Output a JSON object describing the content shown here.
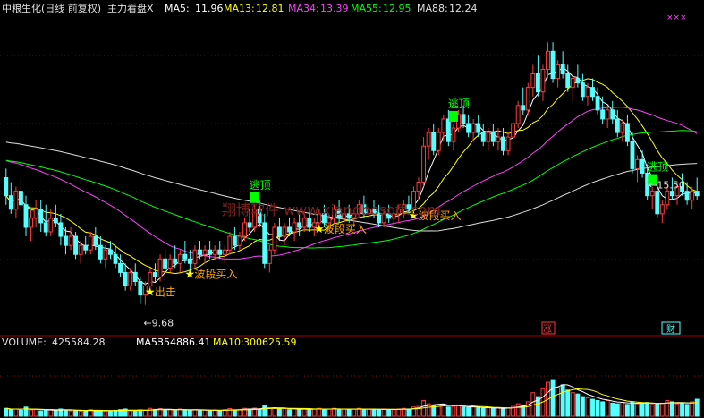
{
  "header": {
    "stock_name": "中粮生化(日线 前复权)",
    "indicator": "主力看盘X",
    "ma5_label": "MA5:",
    "ma5_value": "11.96",
    "ma13_label": "MA13:",
    "ma13_value": "12.81",
    "ma34_label": "MA34:",
    "ma34_value": "13.39",
    "ma55_label": "MA55:",
    "ma55_value": "12.95",
    "ma88_label": "MA88:",
    "ma88_value": "12.24",
    "close_marks": "×××"
  },
  "volume_header": {
    "volume_label": "VOLUME:",
    "volume_value": "425584.28",
    "ma5_label": "MA5:",
    "ma5_value": "354886.41",
    "ma10_label": "MA10:",
    "ma10_value": "300625.59"
  },
  "watermark": "翔博软件 www.xiangbosoft.com",
  "badges": {
    "zhang": "涨",
    "caibao": "财"
  },
  "colors": {
    "up": "#ff3b3b",
    "down": "#54ffff",
    "ma5": "#ffffff",
    "ma13": "#ffff00",
    "ma34": "#ff40ff",
    "ma55": "#00ff00",
    "ma88": "#dddddd",
    "signal": "#ffa500",
    "escape": "#00ff00",
    "grid": "#a00000"
  },
  "chart_data": {
    "type": "candlestick",
    "price_ylim": [
      9.0,
      16.0
    ],
    "volume_ylim": [
      0,
      500000
    ],
    "annotations": [
      {
        "text": "逃顶",
        "bar": 50
      },
      {
        "text": "逃顶",
        "bar": 90
      },
      {
        "text": "逃顶",
        "bar": 130
      },
      {
        "text": "出击",
        "bar": 29
      },
      {
        "text": "波段买入",
        "bar": 37
      },
      {
        "text": "波段买入",
        "bar": 63
      },
      {
        "text": "波段买入",
        "bar": 82
      },
      {
        "text": "15.50",
        "bar": 130
      },
      {
        "text": "9.68",
        "bar": 28
      }
    ],
    "ohlc": [
      [
        12.5,
        12.7,
        11.9,
        12.1
      ],
      [
        12.1,
        12.4,
        11.7,
        11.8
      ],
      [
        11.8,
        12.3,
        11.6,
        12.2
      ],
      [
        12.2,
        12.5,
        11.8,
        11.9
      ],
      [
        11.9,
        12.1,
        11.2,
        11.4
      ],
      [
        11.4,
        11.8,
        11.1,
        11.6
      ],
      [
        11.6,
        12.0,
        11.4,
        11.8
      ],
      [
        11.8,
        12.0,
        11.3,
        11.5
      ],
      [
        11.5,
        11.9,
        11.2,
        11.3
      ],
      [
        11.3,
        11.8,
        11.2,
        11.6
      ],
      [
        11.6,
        11.9,
        11.4,
        11.5
      ],
      [
        11.5,
        11.7,
        11.0,
        11.2
      ],
      [
        11.2,
        11.4,
        10.8,
        11.0
      ],
      [
        11.0,
        11.4,
        10.9,
        11.2
      ],
      [
        11.2,
        11.3,
        10.7,
        10.8
      ],
      [
        10.8,
        11.1,
        10.6,
        11.0
      ],
      [
        11.0,
        11.2,
        10.8,
        10.9
      ],
      [
        10.9,
        11.3,
        10.8,
        11.2
      ],
      [
        11.2,
        11.4,
        10.9,
        11.0
      ],
      [
        11.0,
        11.2,
        10.6,
        10.7
      ],
      [
        10.7,
        11.0,
        10.5,
        10.9
      ],
      [
        10.9,
        11.1,
        10.7,
        10.8
      ],
      [
        10.8,
        11.0,
        10.5,
        10.6
      ],
      [
        10.6,
        10.8,
        10.3,
        10.4
      ],
      [
        10.4,
        10.6,
        10.0,
        10.1
      ],
      [
        10.1,
        10.5,
        10.0,
        10.4
      ],
      [
        10.4,
        10.6,
        10.1,
        10.2
      ],
      [
        10.2,
        10.3,
        9.7,
        9.9
      ],
      [
        9.9,
        10.2,
        9.68,
        10.1
      ],
      [
        10.1,
        10.5,
        10.0,
        10.4
      ],
      [
        10.4,
        10.6,
        10.2,
        10.3
      ],
      [
        10.3,
        10.8,
        10.2,
        10.7
      ],
      [
        10.7,
        10.9,
        10.4,
        10.5
      ],
      [
        10.5,
        10.8,
        10.4,
        10.7
      ],
      [
        10.7,
        11.0,
        10.5,
        10.6
      ],
      [
        10.6,
        10.9,
        10.4,
        10.8
      ],
      [
        10.8,
        11.1,
        10.6,
        10.7
      ],
      [
        10.7,
        10.9,
        10.4,
        10.6
      ],
      [
        10.6,
        11.0,
        10.5,
        10.9
      ],
      [
        10.9,
        11.1,
        10.7,
        10.8
      ],
      [
        10.8,
        11.0,
        10.6,
        10.9
      ],
      [
        10.9,
        11.1,
        10.7,
        10.8
      ],
      [
        10.8,
        11.0,
        10.7,
        10.9
      ],
      [
        10.9,
        11.1,
        10.7,
        10.8
      ],
      [
        10.8,
        11.0,
        10.6,
        10.9
      ],
      [
        10.9,
        11.3,
        10.8,
        11.2
      ],
      [
        11.2,
        11.4,
        10.9,
        11.0
      ],
      [
        11.0,
        11.3,
        10.9,
        11.2
      ],
      [
        11.2,
        11.6,
        11.1,
        11.5
      ],
      [
        11.5,
        11.8,
        11.3,
        11.4
      ],
      [
        11.4,
        11.9,
        11.3,
        11.8
      ],
      [
        11.8,
        12.0,
        11.4,
        11.5
      ],
      [
        11.5,
        11.7,
        10.5,
        10.6
      ],
      [
        10.6,
        11.0,
        10.4,
        10.9
      ],
      [
        10.9,
        11.5,
        10.8,
        11.4
      ],
      [
        11.4,
        11.6,
        11.1,
        11.2
      ],
      [
        11.2,
        11.5,
        11.0,
        11.4
      ],
      [
        11.4,
        11.6,
        11.2,
        11.3
      ],
      [
        11.3,
        11.6,
        11.1,
        11.5
      ],
      [
        11.5,
        11.7,
        11.2,
        11.4
      ],
      [
        11.4,
        11.7,
        11.3,
        11.6
      ],
      [
        11.6,
        11.8,
        11.3,
        11.4
      ],
      [
        11.4,
        11.6,
        11.2,
        11.5
      ],
      [
        11.5,
        11.8,
        11.4,
        11.7
      ],
      [
        11.7,
        11.9,
        11.4,
        11.5
      ],
      [
        11.5,
        11.7,
        11.3,
        11.6
      ],
      [
        11.6,
        11.9,
        11.5,
        11.8
      ],
      [
        11.8,
        12.0,
        11.5,
        11.6
      ],
      [
        11.6,
        11.8,
        11.4,
        11.7
      ],
      [
        11.7,
        11.9,
        11.5,
        11.6
      ],
      [
        11.6,
        11.8,
        11.4,
        11.7
      ],
      [
        11.7,
        12.0,
        11.6,
        11.9
      ],
      [
        11.9,
        12.1,
        11.6,
        11.7
      ],
      [
        11.7,
        11.9,
        11.5,
        11.8
      ],
      [
        11.8,
        12.0,
        11.6,
        11.7
      ],
      [
        11.7,
        11.9,
        11.4,
        11.5
      ],
      [
        11.5,
        11.8,
        11.4,
        11.7
      ],
      [
        11.7,
        11.9,
        11.5,
        11.6
      ],
      [
        11.6,
        11.8,
        11.4,
        11.7
      ],
      [
        11.7,
        11.9,
        11.5,
        11.8
      ],
      [
        11.8,
        12.0,
        11.6,
        11.9
      ],
      [
        11.9,
        12.1,
        11.7,
        11.8
      ],
      [
        11.8,
        12.3,
        11.7,
        12.2
      ],
      [
        12.2,
        12.5,
        12.0,
        12.4
      ],
      [
        12.4,
        13.4,
        12.3,
        13.2
      ],
      [
        13.2,
        13.6,
        12.9,
        13.5
      ],
      [
        13.5,
        13.7,
        13.0,
        13.1
      ],
      [
        13.1,
        13.6,
        13.0,
        13.5
      ],
      [
        13.5,
        13.9,
        13.3,
        13.8
      ],
      [
        13.8,
        14.0,
        13.2,
        13.3
      ],
      [
        13.3,
        13.7,
        13.1,
        13.6
      ],
      [
        13.6,
        14.0,
        13.5,
        13.9
      ],
      [
        13.9,
        14.1,
        13.6,
        13.7
      ],
      [
        13.7,
        13.9,
        13.4,
        13.5
      ],
      [
        13.5,
        13.8,
        13.3,
        13.7
      ],
      [
        13.7,
        13.9,
        13.4,
        13.5
      ],
      [
        13.5,
        13.7,
        13.2,
        13.3
      ],
      [
        13.3,
        13.6,
        13.1,
        13.5
      ],
      [
        13.5,
        13.7,
        13.2,
        13.3
      ],
      [
        13.3,
        13.6,
        13.1,
        13.4
      ],
      [
        13.4,
        13.6,
        13.0,
        13.1
      ],
      [
        13.1,
        13.5,
        13.0,
        13.4
      ],
      [
        13.4,
        13.8,
        13.3,
        13.7
      ],
      [
        13.7,
        14.2,
        13.6,
        14.1
      ],
      [
        14.1,
        14.5,
        13.9,
        14.0
      ],
      [
        14.0,
        14.6,
        13.9,
        14.5
      ],
      [
        14.5,
        15.0,
        14.3,
        14.8
      ],
      [
        14.8,
        15.2,
        14.3,
        14.4
      ],
      [
        14.4,
        15.0,
        14.2,
        14.9
      ],
      [
        14.9,
        15.5,
        14.7,
        15.3
      ],
      [
        15.3,
        15.5,
        14.6,
        14.7
      ],
      [
        14.7,
        15.1,
        14.5,
        15.0
      ],
      [
        15.0,
        15.3,
        14.7,
        14.8
      ],
      [
        14.8,
        15.0,
        14.4,
        14.5
      ],
      [
        14.5,
        14.8,
        14.2,
        14.7
      ],
      [
        14.7,
        15.0,
        14.5,
        14.6
      ],
      [
        14.6,
        14.8,
        14.2,
        14.3
      ],
      [
        14.3,
        14.6,
        14.1,
        14.5
      ],
      [
        14.5,
        14.7,
        14.2,
        14.3
      ],
      [
        14.3,
        14.5,
        13.9,
        14.0
      ],
      [
        14.0,
        14.3,
        13.7,
        13.8
      ],
      [
        13.8,
        14.1,
        13.6,
        14.0
      ],
      [
        14.0,
        14.2,
        13.7,
        13.8
      ],
      [
        13.8,
        14.0,
        13.4,
        13.5
      ],
      [
        13.5,
        13.8,
        13.3,
        13.7
      ],
      [
        13.7,
        13.9,
        13.2,
        13.3
      ],
      [
        13.3,
        13.5,
        12.6,
        12.7
      ],
      [
        12.7,
        13.0,
        12.4,
        12.9
      ],
      [
        12.9,
        13.1,
        12.5,
        12.6
      ],
      [
        12.6,
        12.8,
        12.0,
        12.1
      ],
      [
        12.1,
        12.3,
        11.8,
        12.2
      ],
      [
        12.2,
        12.4,
        11.6,
        11.7
      ],
      [
        11.7,
        12.0,
        11.5,
        11.9
      ],
      [
        11.9,
        12.3,
        11.8,
        12.2
      ],
      [
        12.2,
        12.5,
        12.0,
        12.1
      ],
      [
        12.1,
        12.4,
        11.9,
        12.3
      ],
      [
        12.3,
        12.6,
        12.1,
        12.2
      ],
      [
        12.2,
        12.4,
        11.9,
        12.0
      ],
      [
        12.0,
        12.3,
        11.8,
        12.2
      ],
      [
        12.2,
        12.5,
        12.0,
        12.1
      ]
    ],
    "volume": [
      60,
      50,
      55,
      45,
      70,
      48,
      52,
      40,
      45,
      50,
      42,
      55,
      48,
      40,
      45,
      38,
      42,
      50,
      40,
      45,
      38,
      40,
      45,
      50,
      55,
      42,
      40,
      48,
      45,
      60,
      52,
      58,
      48,
      50,
      45,
      55,
      48,
      42,
      50,
      45,
      48,
      40,
      45,
      42,
      50,
      58,
      48,
      52,
      60,
      55,
      62,
      55,
      80,
      60,
      65,
      55,
      58,
      50,
      55,
      52,
      58,
      50,
      55,
      60,
      52,
      55,
      60,
      50,
      55,
      52,
      55,
      60,
      50,
      55,
      52,
      48,
      55,
      50,
      52,
      55,
      60,
      55,
      70,
      75,
      120,
      95,
      80,
      85,
      90,
      70,
      75,
      80,
      70,
      65,
      70,
      65,
      60,
      65,
      58,
      62,
      58,
      65,
      75,
      95,
      85,
      110,
      180,
      150,
      210,
      260,
      280,
      220,
      240,
      200,
      180,
      170,
      150,
      140,
      130,
      120,
      110,
      120,
      100,
      95,
      105,
      90,
      110,
      95,
      100,
      105,
      90,
      95,
      100,
      120,
      110,
      95,
      100,
      90,
      110,
      130
    ]
  }
}
